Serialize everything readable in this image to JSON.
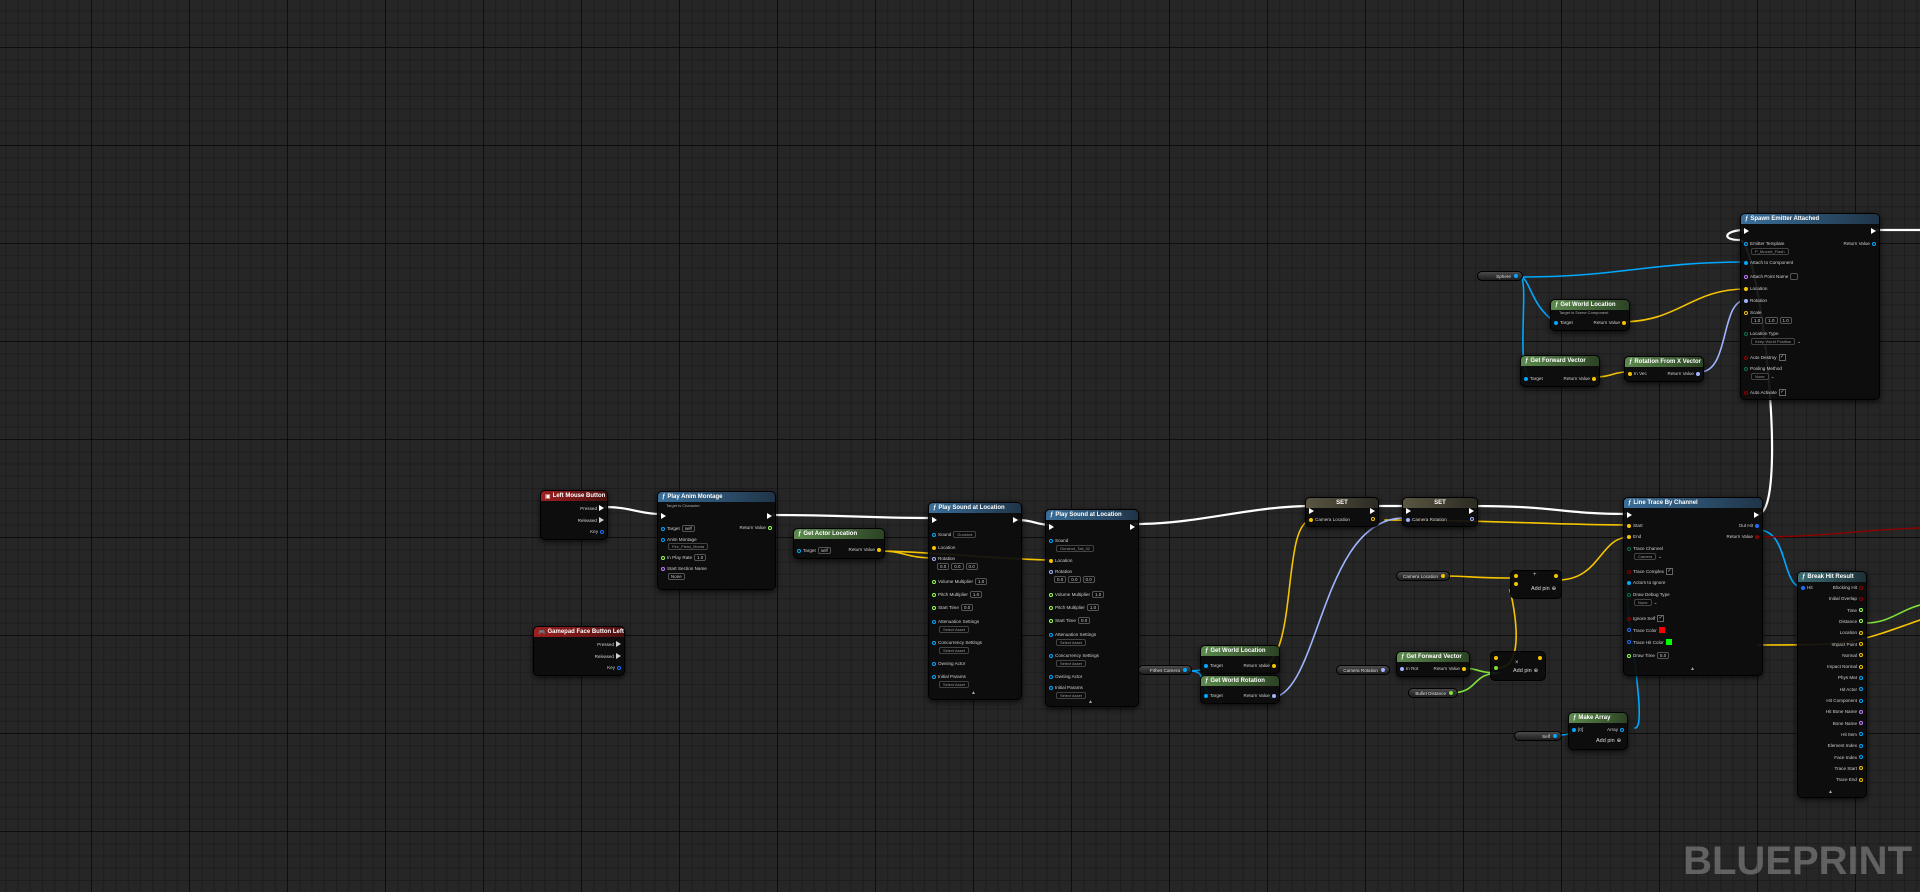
{
  "watermark": "BLUEPRINT",
  "colors": {
    "exec": "#ffffff",
    "object": "#00a8ff",
    "vector": "#f5c400",
    "rotator": "#a0b4ff",
    "float": "#9bff5a",
    "bool": "#8b0000",
    "name": "#c67bff",
    "struct": "#1f6fff",
    "green": "#7ee03a"
  },
  "nodes": {
    "lmb": {
      "title": "Left Mouse Button",
      "pressed": "Pressed",
      "released": "Released",
      "key": "Key"
    },
    "gamepad": {
      "title": "Gamepad Face Button Left",
      "pressed": "Pressed",
      "released": "Released",
      "key": "Key"
    },
    "montage": {
      "title": "Play Anim Montage",
      "sub": "Target is Character",
      "target": "Target",
      "self": "self",
      "anim": "Anim Montage",
      "anim_val": "Fire_Pistol_Monta",
      "rate": "In Play Rate",
      "rate_val": "1.0",
      "section": "Start Section Name",
      "section_val": "None",
      "ret": "Return Value"
    },
    "actorloc": {
      "title": "Get Actor Location",
      "sub": "Target is Actor",
      "target": "Target",
      "self": "self",
      "ret": "Return Value"
    },
    "sound1": {
      "title": "Play Sound at Location",
      "sound": "Sound",
      "sound_val": "Gunshot",
      "location": "Location",
      "rotation": "Rotation",
      "r1": "0.0",
      "r2": "0.0",
      "r3": "0.0",
      "vol": "Volume Multiplier",
      "vol_val": "1.0",
      "pitch": "Pitch Multiplier",
      "pitch_val": "1.0",
      "start": "Start Time",
      "start_val": "0.0",
      "atten": "Attenuation Settings",
      "select": "Select Asset",
      "conc": "Concurrency Settings",
      "owning": "Owning Actor",
      "init": "Initial Params"
    },
    "sound2": {
      "title": "Play Sound at Location",
      "sound": "Sound",
      "sound_val": "Gunshot_Tail_02",
      "location": "Location",
      "rotation": "Rotation",
      "r1": "0.0",
      "r2": "0.0",
      "r3": "0.0",
      "vol": "Volume Multiplier",
      "vol_val": "1.0",
      "pitch": "Pitch Multiplier",
      "pitch_val": "1.0",
      "start": "Start Time",
      "start_val": "0.0",
      "atten": "Attenuation Settings",
      "select": "Select Asset",
      "conc": "Concurrency Settings",
      "owning": "Owning Actor",
      "init": "Initial Params"
    },
    "set1": {
      "title": "SET",
      "label": "Camera Location"
    },
    "set2": {
      "title": "SET",
      "label": "Camera Rotation"
    },
    "fpcam": {
      "title": "Fithes Camera"
    },
    "gwl1": {
      "title": "Get World Location",
      "sub": "Target is Scene Component",
      "target": "Target",
      "ret": "Return Value"
    },
    "gwr": {
      "title": "Get World Rotation",
      "sub": "Target is Scene Component",
      "target": "Target",
      "ret": "Return Value"
    },
    "camrot": {
      "title": "Camera Rotation"
    },
    "camloc": {
      "title": "Camera Location"
    },
    "gfv2": {
      "title": "Get Forward Vector",
      "target": "In Rot",
      "ret": "Return Value"
    },
    "bullet": {
      "title": "Bullet Distance"
    },
    "add1": {
      "addpin": "Add pin",
      "op": "+"
    },
    "add2": {
      "addpin": "Add pin",
      "op": "×"
    },
    "self2": {
      "title": "Self"
    },
    "makearr": {
      "title": "Make Array",
      "in": "[0]",
      "out": "Array",
      "addpin": "Add pin"
    },
    "sphere": {
      "title": "Sphere"
    },
    "gwl2": {
      "title": "Get World Location",
      "sub": "Target is Scene Component",
      "target": "Target",
      "ret": "Return Value"
    },
    "gfv": {
      "title": "Get Forward Vector",
      "sub": "Target is Scene Component",
      "target": "Target",
      "ret": "Return Value"
    },
    "rfx": {
      "title": "Rotation From X Vector",
      "in": "In Vec",
      "ret": "Return Value"
    },
    "spawn": {
      "title": "Spawn Emitter Attached",
      "template": "Emitter Template",
      "template_val": "P_Muzzle_Flash",
      "attach": "Attach to Component",
      "point": "Attach Point Name",
      "location": "Location",
      "rotation": "Rotation",
      "scale": "Scale",
      "s1": "1.0",
      "s2": "1.0",
      "s3": "1.0",
      "loctype": "Location Type",
      "loctype_val": "Keep World Position",
      "autodestroy": "Auto Destroy",
      "pooling": "Pooling Method",
      "pooling_val": "None",
      "autoactivate": "Auto Activate",
      "ret": "Return Value"
    },
    "trace": {
      "title": "Line Trace By Channel",
      "start": "Start",
      "end": "End",
      "channel": "Trace Channel",
      "channel_val": "Camera",
      "complex": "Trace Complex",
      "ignore": "Actors to Ignore",
      "debug": "Draw Debug Type",
      "debug_val": "None",
      "ignoreself": "Ignore Self",
      "tcolor": "Trace Color",
      "thit": "Trace Hit Color",
      "dtime": "Draw Time",
      "dtime_val": "5.0",
      "outhit": "Out Hit",
      "ret": "Return Value"
    },
    "break": {
      "title": "Break Hit Result",
      "hit": "Hit",
      "items": [
        "Blocking Hit",
        "Initial Overlap",
        "Time",
        "Distance",
        "Location",
        "Impact Point",
        "Normal",
        "Impact Normal",
        "Phys Mat",
        "Hit Actor",
        "Hit Component",
        "Hit Bone Name",
        "Bone Name",
        "Hit Item",
        "Element Index",
        "Face Index",
        "Trace Start",
        "Trace End"
      ]
    }
  }
}
